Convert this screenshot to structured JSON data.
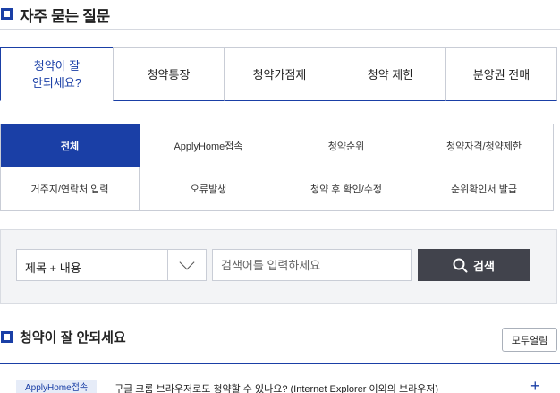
{
  "header": {
    "title": "자주 묻는 질문",
    "icon": "square-bullet-icon"
  },
  "tabs": [
    {
      "label": "청약이 잘\n안되세요?",
      "active": true
    },
    {
      "label": "청약통장",
      "active": false
    },
    {
      "label": "청약가점제",
      "active": false
    },
    {
      "label": "청약 제한",
      "active": false
    },
    {
      "label": "분양권 전매",
      "active": false
    }
  ],
  "categories": [
    {
      "label": "전체",
      "active": true
    },
    {
      "label": "ApplyHome접속",
      "active": false
    },
    {
      "label": "청약순위",
      "active": false
    },
    {
      "label": "청약자격/청약제한",
      "active": false
    },
    {
      "label": "거주지/연락처 입력",
      "active": false
    },
    {
      "label": "오류발생",
      "active": false
    },
    {
      "label": "청약 후 확인/수정",
      "active": false
    },
    {
      "label": "순위확인서 발급",
      "active": false
    }
  ],
  "search": {
    "select_value": "제목 + 내용",
    "placeholder": "검색어를 입력하세요",
    "button_label": "검색"
  },
  "section": {
    "title": "청약이 잘 안되세요",
    "expand_all_label": "모두열림"
  },
  "faq": [
    {
      "badge": "ApplyHome접속",
      "question": "구글 크롬 브라우저로도 청약할 수 있나요? (Internet Explorer 이외의 브라우저)",
      "toggle": "+"
    }
  ],
  "colors": {
    "accent": "#1a3fa6",
    "button_dark": "#41434c",
    "panel_bg": "#f3f4f6"
  }
}
